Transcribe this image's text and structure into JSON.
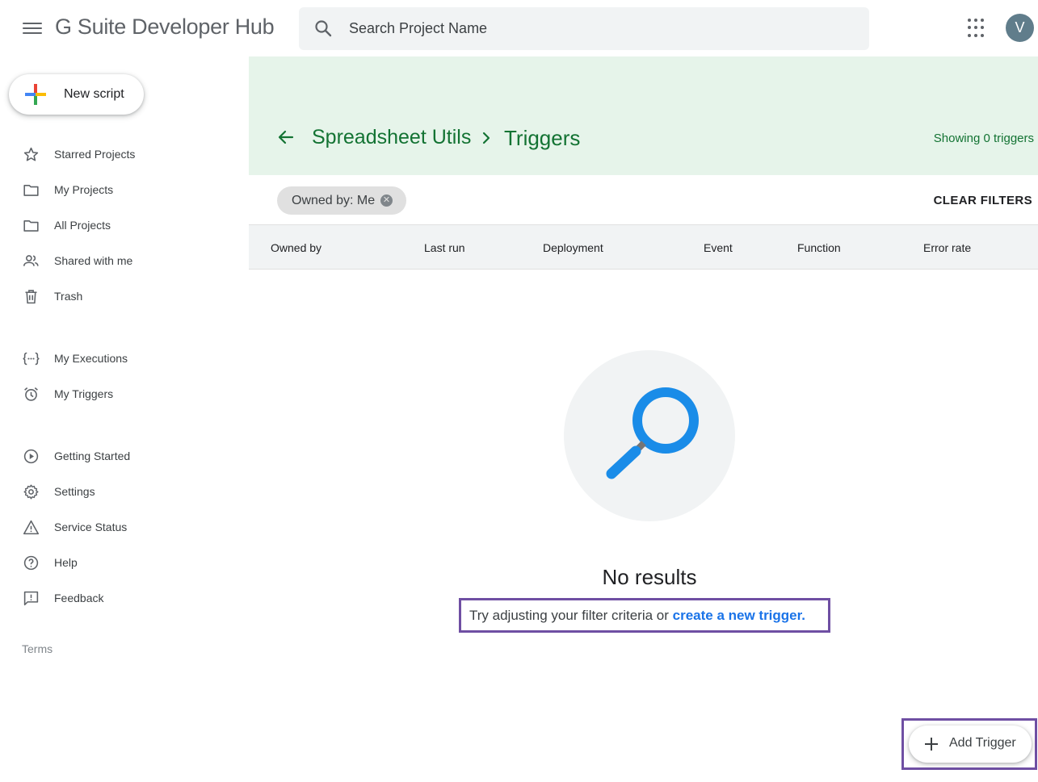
{
  "app": {
    "title": "G Suite Developer Hub",
    "avatar_initial": "V"
  },
  "search": {
    "placeholder": "Search Project Name"
  },
  "sidebar": {
    "new_script_label": "New script",
    "items": [
      {
        "label": "Starred Projects",
        "icon": "star-icon"
      },
      {
        "label": "My Projects",
        "icon": "folder-icon"
      },
      {
        "label": "All Projects",
        "icon": "folder-icon"
      },
      {
        "label": "Shared with me",
        "icon": "people-icon"
      },
      {
        "label": "Trash",
        "icon": "trash-icon"
      },
      {
        "label": "My Executions",
        "icon": "executions-icon"
      },
      {
        "label": "My Triggers",
        "icon": "alarm-icon"
      },
      {
        "label": "Getting Started",
        "icon": "play-circle-icon"
      },
      {
        "label": "Settings",
        "icon": "gear-icon"
      },
      {
        "label": "Service Status",
        "icon": "warning-icon"
      },
      {
        "label": "Help",
        "icon": "help-icon"
      },
      {
        "label": "Feedback",
        "icon": "feedback-icon"
      }
    ],
    "terms": "Terms"
  },
  "header": {
    "project": "Spreadsheet Utils",
    "page": "Triggers",
    "showing": "Showing 0 triggers"
  },
  "filters": {
    "chip": "Owned by: Me",
    "clear": "CLEAR FILTERS"
  },
  "table": {
    "columns": [
      "Owned by",
      "Last run",
      "Deployment",
      "Event",
      "Function",
      "Error rate"
    ]
  },
  "empty": {
    "title": "No results",
    "hint_prefix": "Try adjusting your filter criteria or ",
    "hint_link": "create a new trigger."
  },
  "fab": {
    "label": "Add Trigger"
  },
  "colors": {
    "accent_green": "#137333",
    "header_bg": "#e6f4ea",
    "link_blue": "#1a73e8",
    "highlight_border": "#6f4fa3",
    "magnifier_blue": "#1a8ce8"
  }
}
